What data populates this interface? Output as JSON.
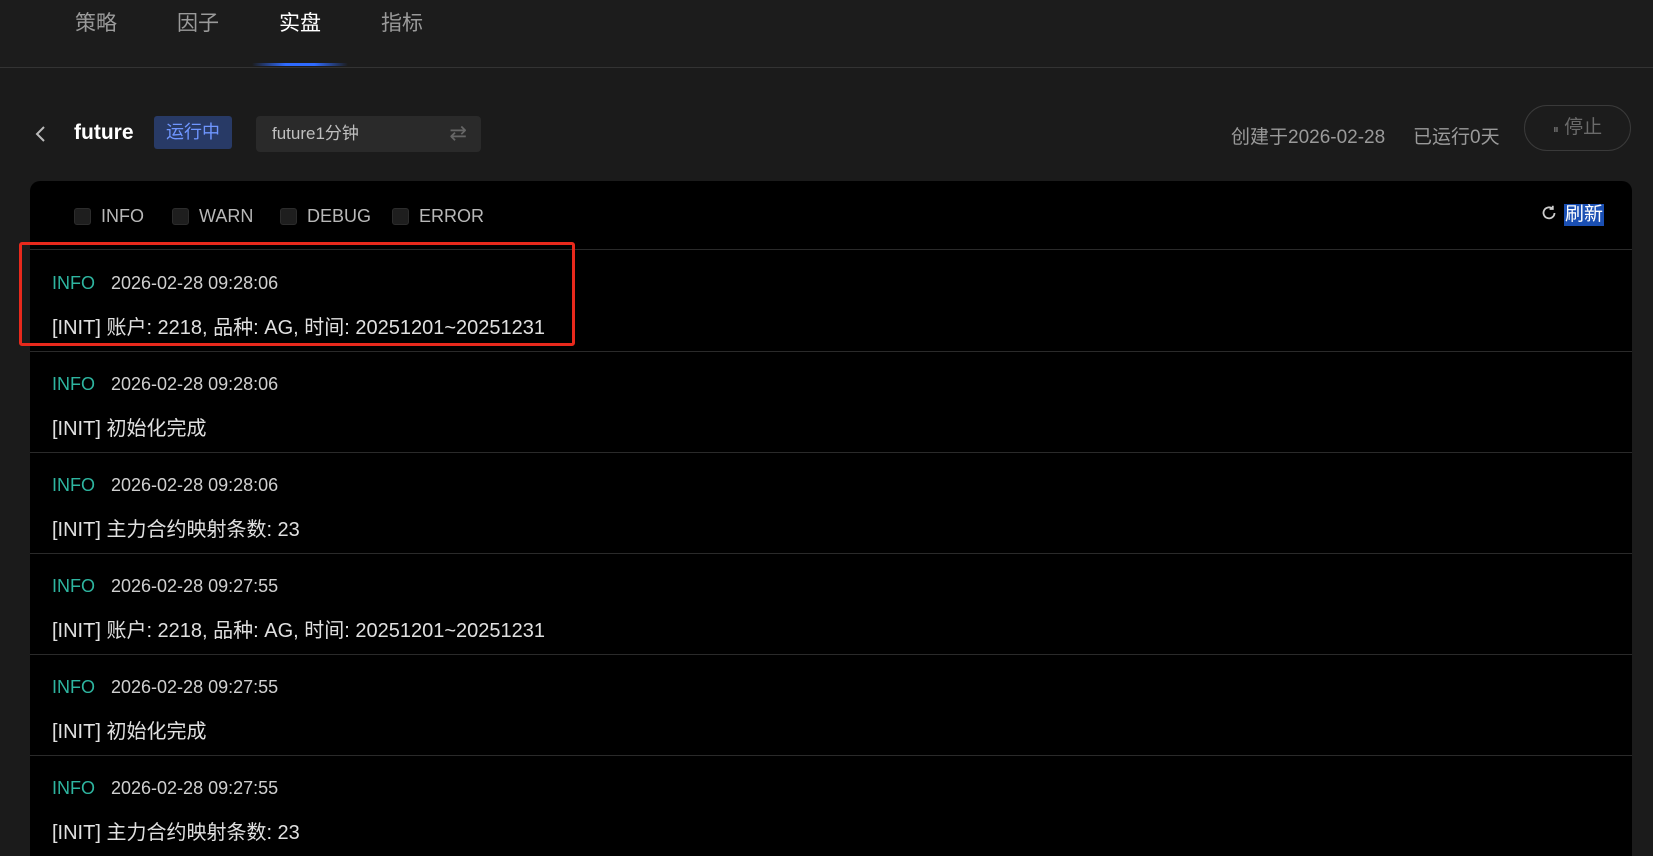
{
  "nav": {
    "tabs": [
      {
        "label": "策略"
      },
      {
        "label": "因子"
      },
      {
        "label": "实盘",
        "active": true
      },
      {
        "label": "指标"
      }
    ]
  },
  "header": {
    "strategy_name": "future",
    "status": "运行中",
    "selector_value": "future1分钟",
    "created": "创建于2026-02-28",
    "running": "已运行0天",
    "stop_label": "停止",
    "stop_icon": "⏸"
  },
  "filters": [
    {
      "label": "INFO",
      "checked": false
    },
    {
      "label": "WARN",
      "checked": false
    },
    {
      "label": "DEBUG",
      "checked": false
    },
    {
      "label": "ERROR",
      "checked": false
    }
  ],
  "refresh_label": "刷新",
  "logs": [
    {
      "level": "INFO",
      "time": "2026-02-28 09:28:06",
      "message": "[INIT] 账户: 2218, 品种: AG, 时间: 20251201~20251231"
    },
    {
      "level": "INFO",
      "time": "2026-02-28 09:28:06",
      "message": "[INIT] 初始化完成"
    },
    {
      "level": "INFO",
      "time": "2026-02-28 09:28:06",
      "message": "[INIT] 主力合约映射条数: 23"
    },
    {
      "level": "INFO",
      "time": "2026-02-28 09:27:55",
      "message": "[INIT] 账户: 2218, 品种: AG, 时间: 20251201~20251231"
    },
    {
      "level": "INFO",
      "time": "2026-02-28 09:27:55",
      "message": "[INIT] 初始化完成"
    },
    {
      "level": "INFO",
      "time": "2026-02-28 09:27:55",
      "message": "[INIT] 主力合约映射条数: 23"
    }
  ],
  "colors": {
    "accent": "#2f6bff",
    "info_level": "#2eb5a0",
    "highlight": "#e8291c",
    "badge_text": "#6f96ff",
    "badge_bg": "#283a66"
  }
}
